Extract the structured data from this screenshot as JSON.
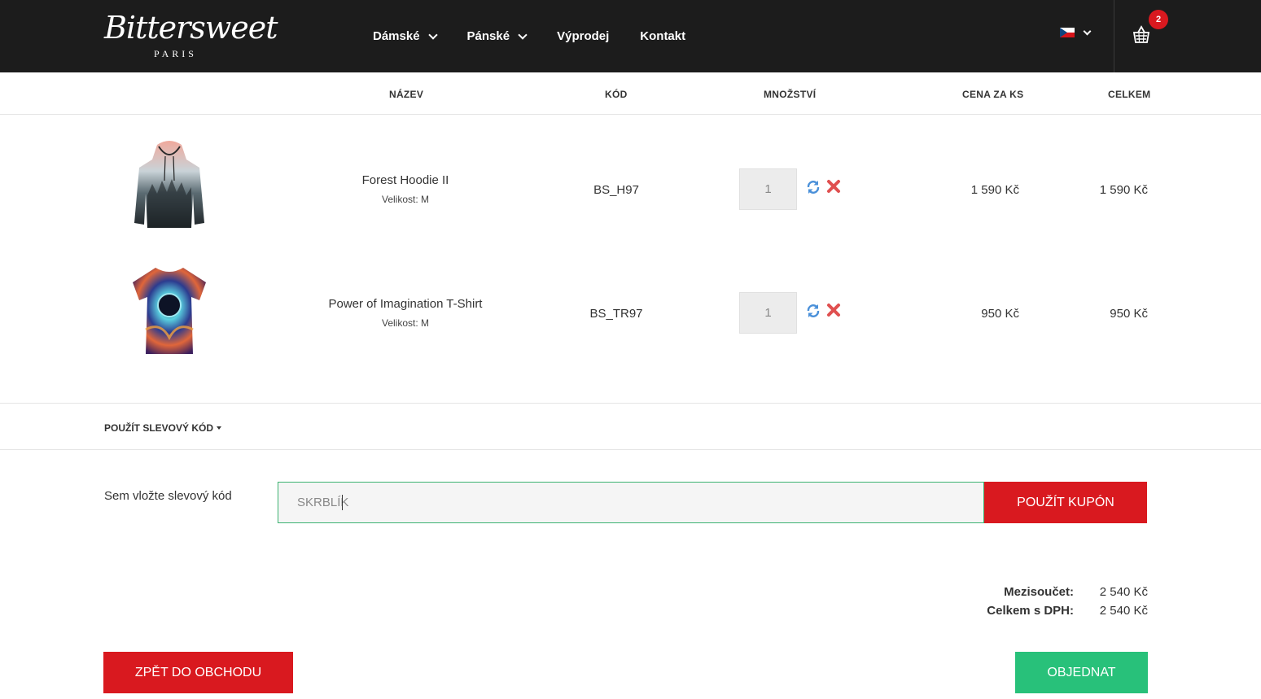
{
  "header": {
    "logo": {
      "name": "Bittersweet",
      "sub": "PARIS"
    },
    "nav": [
      {
        "label": "Dámské",
        "has_dropdown": true
      },
      {
        "label": "Pánské",
        "has_dropdown": true
      },
      {
        "label": "Výprodej",
        "has_dropdown": false
      },
      {
        "label": "Kontakt",
        "has_dropdown": false
      }
    ],
    "language": {
      "flag": "cz-flag-icon"
    },
    "cart": {
      "icon": "basket-icon",
      "count": "2"
    }
  },
  "table": {
    "columns": [
      "NÁZEV",
      "KÓD",
      "MNOŽSTVÍ",
      "CENA ZA KS",
      "CELKEM"
    ],
    "rows": [
      {
        "name": "Forest Hoodie II",
        "size": "Velikost: M",
        "code": "BS_H97",
        "qty": "1",
        "unit_price": "1 590 Kč",
        "total": "1 590 Kč"
      },
      {
        "name": "Power of Imagination T-Shirt",
        "size": "Velikost: M",
        "code": "BS_TR97",
        "qty": "1",
        "unit_price": "950 Kč",
        "total": "950 Kč"
      }
    ]
  },
  "coupon": {
    "toggle_label": "POUŽÍT SLEVOVÝ KÓD",
    "field_label": "Sem vložte slevový kód",
    "value": "SKRBLÍK",
    "button": "POUŽÍT KUPÓN"
  },
  "summary": {
    "subtotal_label": "Mezisoučet:",
    "subtotal_value": "2 540 Kč",
    "total_label": "Celkem s DPH:",
    "total_value": "2 540 Kč"
  },
  "actions": {
    "back": "ZPĚT DO OBCHODU",
    "order": "OBJEDNAT"
  },
  "colors": {
    "header_bg": "#1c1c1c",
    "accent_red": "#d9191f",
    "accent_green": "#28c17a",
    "input_border": "#3cb371"
  }
}
